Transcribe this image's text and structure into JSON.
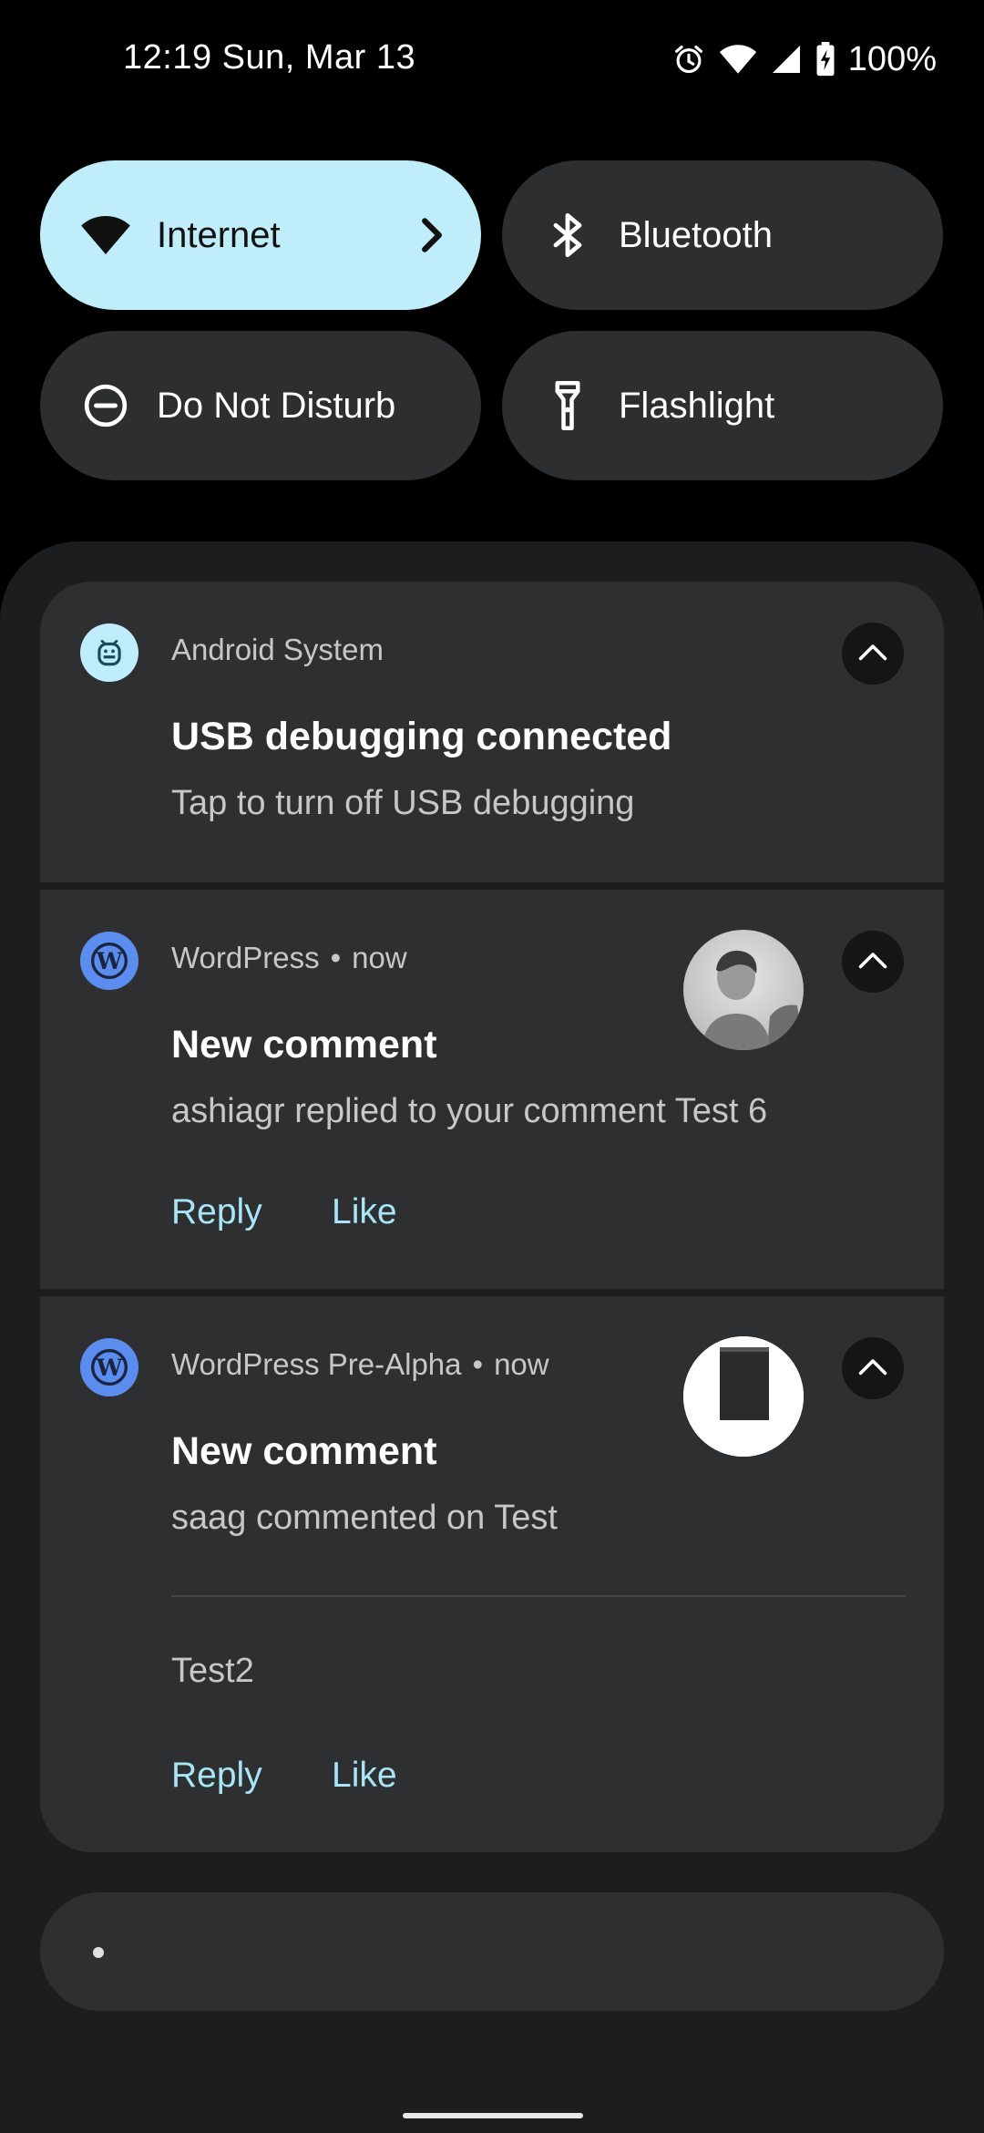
{
  "status_bar": {
    "time_date": "12:19 Sun, Mar 13",
    "battery": "100%",
    "icons": [
      "alarm-icon",
      "wifi-icon",
      "cell-signal-icon",
      "battery-charging-icon"
    ]
  },
  "quick_settings": {
    "tiles": [
      {
        "label": "Internet",
        "icon": "wifi-icon",
        "active": true
      },
      {
        "label": "Bluetooth",
        "icon": "bluetooth-icon",
        "active": false
      },
      {
        "label": "Do Not Disturb",
        "icon": "do-not-disturb-icon",
        "active": false
      },
      {
        "label": "Flashlight",
        "icon": "flashlight-icon",
        "active": false
      }
    ]
  },
  "notifications": [
    {
      "app": "Android System",
      "icon": "android-system-icon",
      "title": "USB debugging connected",
      "text": "Tap to turn off USB debugging"
    },
    {
      "app": "WordPress",
      "time": "now",
      "icon": "wordpress-icon",
      "title": "New comment",
      "text": "ashiagr replied to your comment Test 6",
      "actions": [
        "Reply",
        "Like"
      ]
    },
    {
      "app": "WordPress Pre-Alpha",
      "time": "now",
      "icon": "wordpress-icon",
      "title": "New comment",
      "text": "saag commented on Test",
      "detail": "Test2",
      "actions": [
        "Reply",
        "Like"
      ]
    }
  ],
  "colors": {
    "background": "#000000",
    "shade": "#1c1d1e",
    "card": "#2e2f31",
    "tile": "#2d2e30",
    "tile_active": "#bfeefa",
    "accent_action": "#a8e5f7",
    "wordpress_blue": "#5b8def"
  }
}
